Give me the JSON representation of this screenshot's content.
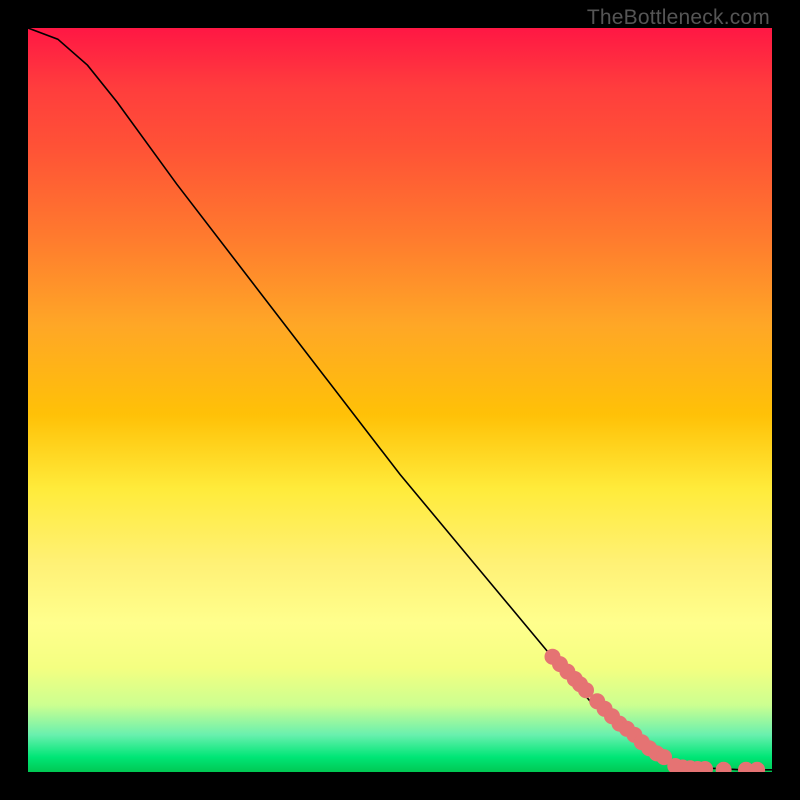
{
  "watermark": "TheBottleneck.com",
  "chart_data": {
    "type": "line",
    "title": "",
    "xlabel": "",
    "ylabel": "",
    "xlim": [
      0,
      100
    ],
    "ylim": [
      0,
      100
    ],
    "curve": [
      {
        "x": 0,
        "y": 100
      },
      {
        "x": 4,
        "y": 98.5
      },
      {
        "x": 8,
        "y": 95
      },
      {
        "x": 12,
        "y": 90
      },
      {
        "x": 20,
        "y": 79
      },
      {
        "x": 30,
        "y": 66
      },
      {
        "x": 40,
        "y": 53
      },
      {
        "x": 50,
        "y": 40
      },
      {
        "x": 60,
        "y": 28
      },
      {
        "x": 70,
        "y": 16
      },
      {
        "x": 76,
        "y": 9
      },
      {
        "x": 80,
        "y": 5.5
      },
      {
        "x": 84,
        "y": 2.5
      },
      {
        "x": 88,
        "y": 1
      },
      {
        "x": 92,
        "y": 0.5
      },
      {
        "x": 96,
        "y": 0.3
      },
      {
        "x": 100,
        "y": 0.3
      }
    ],
    "markers": [
      {
        "x": 70.5,
        "y": 15.5
      },
      {
        "x": 71.5,
        "y": 14.5
      },
      {
        "x": 72.5,
        "y": 13.5
      },
      {
        "x": 73.5,
        "y": 12.5
      },
      {
        "x": 74.2,
        "y": 11.8
      },
      {
        "x": 75.0,
        "y": 11.0
      },
      {
        "x": 76.5,
        "y": 9.5
      },
      {
        "x": 77.5,
        "y": 8.5
      },
      {
        "x": 78.5,
        "y": 7.5
      },
      {
        "x": 79.5,
        "y": 6.5
      },
      {
        "x": 80.5,
        "y": 5.8
      },
      {
        "x": 81.5,
        "y": 5.0
      },
      {
        "x": 82.5,
        "y": 4.0
      },
      {
        "x": 83.5,
        "y": 3.2
      },
      {
        "x": 84.5,
        "y": 2.5
      },
      {
        "x": 85.5,
        "y": 2.0
      },
      {
        "x": 87.0,
        "y": 0.8
      },
      {
        "x": 88.0,
        "y": 0.6
      },
      {
        "x": 89.0,
        "y": 0.5
      },
      {
        "x": 90.0,
        "y": 0.4
      },
      {
        "x": 91.0,
        "y": 0.4
      },
      {
        "x": 93.5,
        "y": 0.3
      },
      {
        "x": 96.5,
        "y": 0.3
      },
      {
        "x": 98.0,
        "y": 0.3
      }
    ],
    "colors": {
      "curve": "#000000",
      "markers": "#e57373"
    }
  }
}
